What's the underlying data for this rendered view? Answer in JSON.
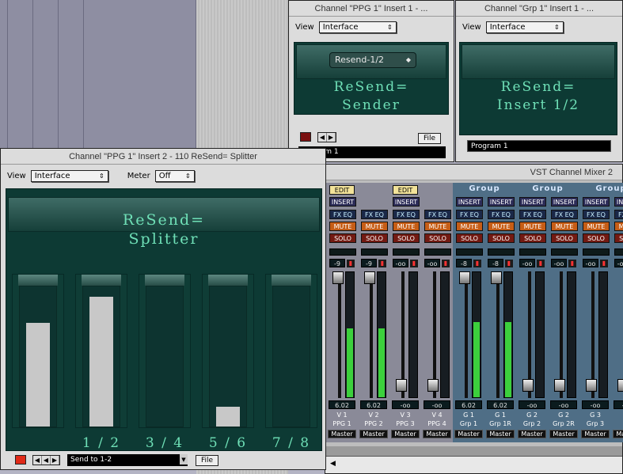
{
  "win_ppg1_i1": {
    "title": "Channel \"PPG 1\" Insert 1 - ...",
    "view_label": "View",
    "view_value": "Interface",
    "preset": "Resend-1/2",
    "display_line1": "ReSend=",
    "display_line2": "Sender",
    "file": "File",
    "program": "Program 1"
  },
  "win_grp1_i1": {
    "title": "Channel \"Grp 1\" Insert 1 - ...",
    "view_label": "View",
    "view_value": "Interface",
    "display_line1": "ReSend=",
    "display_line2": "Insert 1/2",
    "program": "Program 1"
  },
  "splitter": {
    "title": "Channel \"PPG 1\" Insert 2 - 110 ReSend= Splitter",
    "view_label": "View",
    "view_value": "Interface",
    "meter_label": "Meter",
    "meter_value": "Off",
    "display_line1": "ReSend=",
    "display_line2": "Splitter",
    "slots": [
      {
        "label": "",
        "level": 0.73
      },
      {
        "label": "1 / 2",
        "level": 0.91
      },
      {
        "label": "3 / 4",
        "level": 0.0
      },
      {
        "label": "5 / 6",
        "level": 0.14
      },
      {
        "label": "7 / 8",
        "level": 0.0
      }
    ],
    "program": "Send to 1-2",
    "file": "File"
  },
  "mixer": {
    "title": "VST Channel Mixer 2",
    "channels": [
      {
        "top": "EDIT",
        "grp": false,
        "a": {
          "val": "-9",
          "name": "V 1",
          "sub": "PPG 1",
          "peak": "6.02",
          "level": 0.55
        },
        "b": {
          "val": "-9",
          "name": "V 2",
          "sub": "PPG 2",
          "peak": "6.02",
          "level": 0.55
        },
        "master": "Master"
      },
      {
        "top": "EDIT",
        "grp": false,
        "a": {
          "val": "-oo",
          "name": "V 3",
          "sub": "PPG 3",
          "peak": "-oo",
          "level": 0
        },
        "b": {
          "val": "-oo",
          "name": "V 4",
          "sub": "PPG 4",
          "peak": "-oo",
          "level": 0
        },
        "master": "Master"
      },
      {
        "top": "Group",
        "grp": true,
        "a": {
          "val": "-8",
          "name": "G 1",
          "sub": "Grp 1",
          "peak": "6.02",
          "level": 0.6
        },
        "b": {
          "val": "-8",
          "name": "G 1",
          "sub": "Grp 1R",
          "peak": "6.02",
          "level": 0.6
        },
        "master": "Master"
      },
      {
        "top": "Group",
        "grp": true,
        "a": {
          "val": "-oo",
          "name": "G 2",
          "sub": "Grp 2",
          "peak": "-oo",
          "level": 0
        },
        "b": {
          "val": "-oo",
          "name": "G 2",
          "sub": "Grp 2R",
          "peak": "-oo",
          "level": 0
        },
        "master": "Master"
      },
      {
        "top": "Group",
        "grp": true,
        "a": {
          "val": "-oo",
          "name": "G 3",
          "sub": "Grp 3",
          "peak": "-oo",
          "level": 0
        },
        "b": {
          "val": "-oo",
          "name": "",
          "sub": "",
          "peak": "-oo",
          "level": 0
        },
        "master": "Master"
      }
    ],
    "insert": "INSERT",
    "fx": "FX",
    "eq": "EQ",
    "mute": "MUTE",
    "solo": "SOLO"
  }
}
